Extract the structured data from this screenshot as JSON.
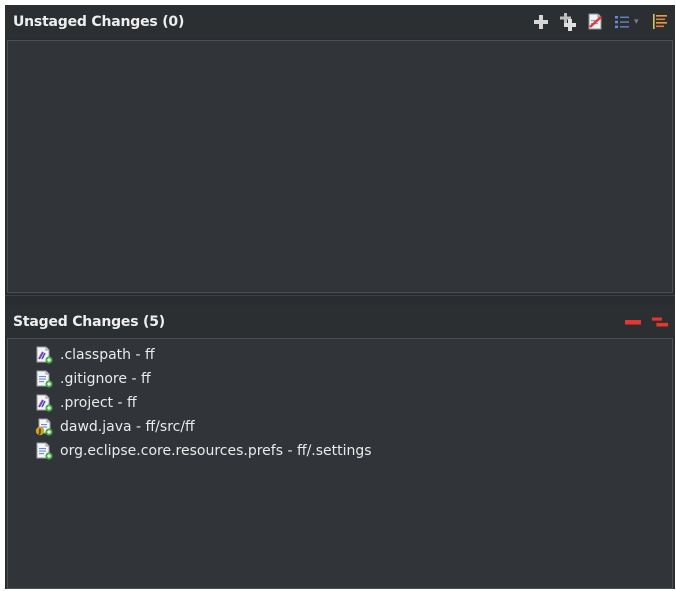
{
  "unstaged": {
    "title": "Unstaged Changes (0)",
    "toolbar": [
      {
        "name": "add-to-index-icon",
        "tooltip": ""
      },
      {
        "name": "add-all-to-index-icon",
        "tooltip": ""
      },
      {
        "name": "remove-file-icon",
        "tooltip": ""
      },
      {
        "name": "presentation-list-icon",
        "tooltip": ""
      },
      {
        "name": "sort-icon",
        "tooltip": ""
      }
    ],
    "files": []
  },
  "staged": {
    "title": "Staged Changes (5)",
    "files": [
      {
        "label": ".classpath - ff",
        "icon": "xml-file-added-icon"
      },
      {
        "label": ".gitignore - ff",
        "icon": "text-file-added-icon"
      },
      {
        "label": ".project - ff",
        "icon": "xml-file-added-icon"
      },
      {
        "label": "dawd.java - ff/src/ff",
        "icon": "java-file-added-icon"
      },
      {
        "label": "org.eclipse.core.resources.prefs - ff/.settings",
        "icon": "text-file-added-icon"
      }
    ]
  },
  "colors": {
    "background": "#2a2d30",
    "panel": "#313539",
    "text": "#eaeaea",
    "remove_red": "#e8352f",
    "add_green": "#3fae3f"
  }
}
